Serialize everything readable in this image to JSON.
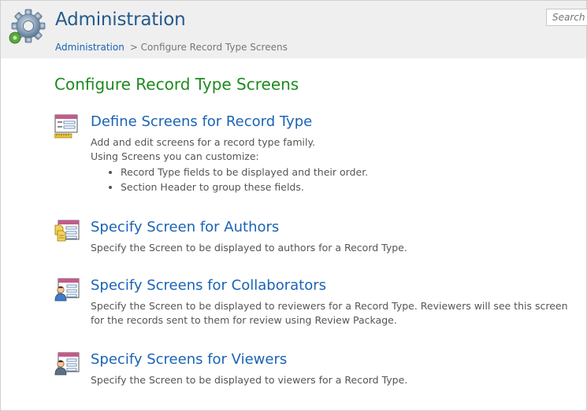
{
  "header": {
    "title": "Administration",
    "breadcrumb": {
      "link": "Administration",
      "current": "> Configure Record Type Screens"
    },
    "search_placeholder": "Search"
  },
  "main": {
    "page_title": "Configure Record Type Screens",
    "sections": [
      {
        "icon": "screen-ruler-icon",
        "title": "Define Screens for Record Type",
        "description_lines": [
          "Add and edit screens for a record type family.",
          "Using Screens you can customize:"
        ],
        "bullets": [
          "Record Type fields to be displayed and their order.",
          "Section Header to group these fields."
        ]
      },
      {
        "icon": "screen-authors-icon",
        "title": "Specify Screen for Authors",
        "description": "Specify the Screen to be displayed to authors for a Record Type."
      },
      {
        "icon": "screen-collaborators-icon",
        "title": "Specify Screens for Collaborators",
        "description": "Specify the Screen to be displayed to reviewers for a Record Type. Reviewers will see this screen for the records sent to them for review using Review Package."
      },
      {
        "icon": "screen-viewers-icon",
        "title": "Specify Screens for Viewers",
        "description": "Specify the Screen to be displayed to viewers for a Record Type."
      }
    ]
  },
  "colors": {
    "title_blue": "#245a8c",
    "link_blue": "#1a63b5",
    "page_title_green": "#1e8a1e",
    "header_bg": "#efefef"
  }
}
